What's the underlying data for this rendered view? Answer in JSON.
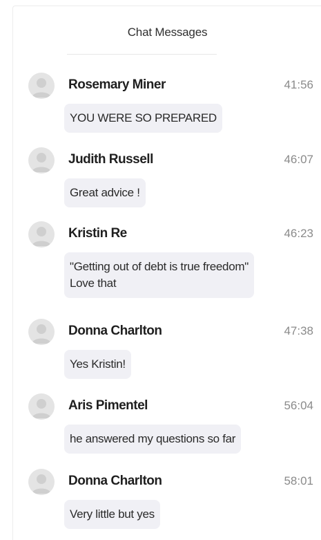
{
  "header": {
    "title": "Chat Messages"
  },
  "messages": [
    {
      "name": "Rosemary Miner",
      "time": "41:56",
      "text": "YOU WERE SO PREPARED",
      "avatar_icon": "default-user-avatar"
    },
    {
      "name": "Judith Russell",
      "time": "46:07",
      "text": "Great advice !",
      "avatar_icon": "default-user-avatar"
    },
    {
      "name": "Kristin Re",
      "time": "46:23",
      "text": "\"Getting out of debt is true freedom\"\nLove that",
      "avatar_icon": "default-user-avatar"
    },
    {
      "name": "Donna Charlton",
      "time": "47:38",
      "text": "Yes Kristin!",
      "avatar_icon": "default-user-avatar"
    },
    {
      "name": "Aris Pimentel",
      "time": "56:04",
      "text": "he answered my questions so far",
      "avatar_icon": "default-user-avatar"
    },
    {
      "name": "Donna Charlton",
      "time": "58:01",
      "text": "Very little but yes",
      "avatar_icon": "default-user-avatar"
    }
  ],
  "colors": {
    "bubble_bg": "#f0f0f5",
    "avatar_bg": "#e4e4e4",
    "avatar_fg": "#cfcfcf",
    "time_text": "#8a8a8a"
  }
}
